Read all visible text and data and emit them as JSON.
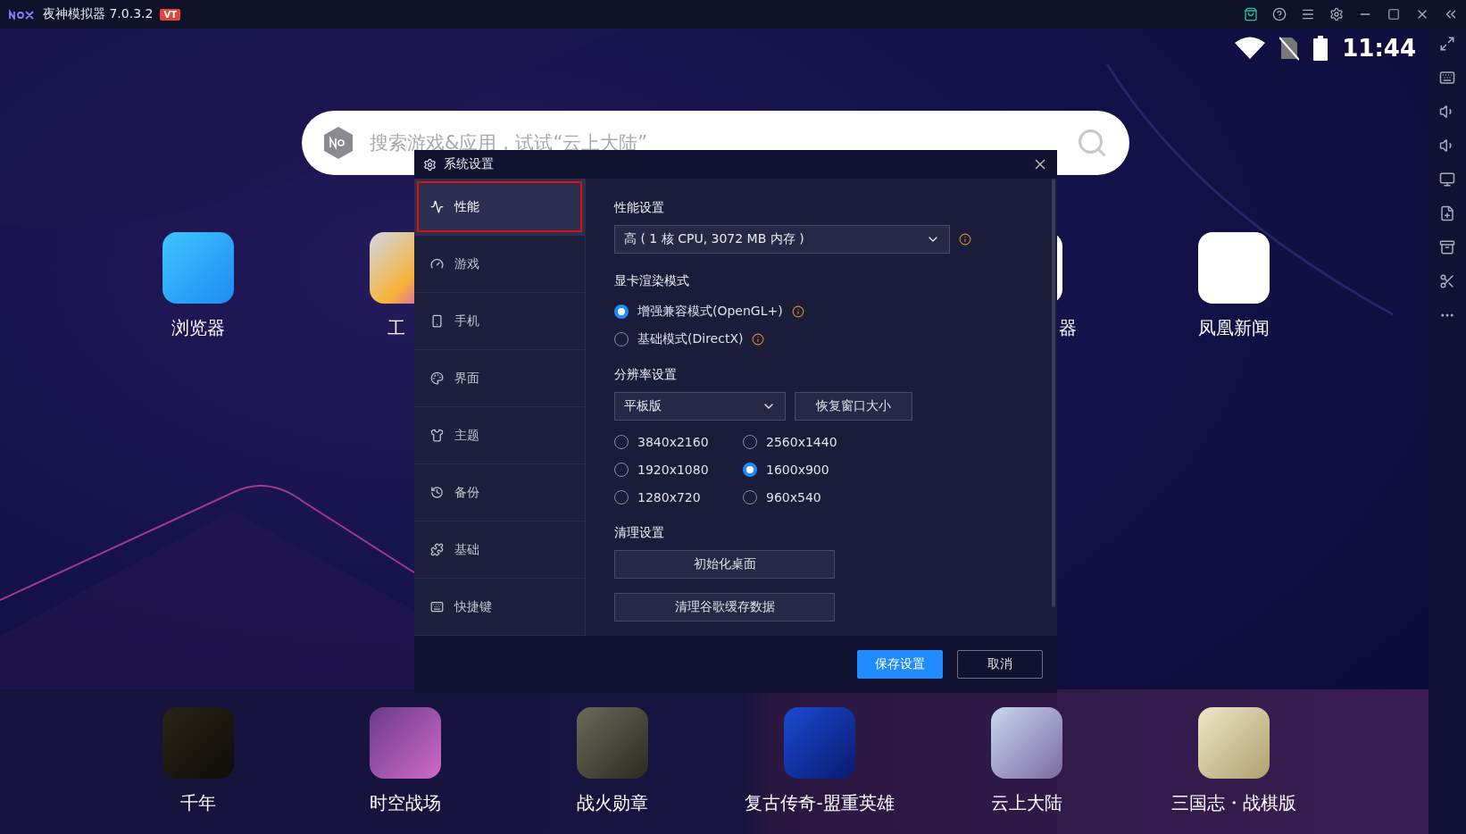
{
  "title_bar": {
    "app_name": "夜神模拟器 7.0.3.2",
    "badge": "VT"
  },
  "status_bar": {
    "time": "11:44"
  },
  "search": {
    "placeholder": "搜索游戏&应用，试试“云上大陆”"
  },
  "home_apps": [
    {
      "name": "浏览器",
      "kind": "full"
    },
    {
      "name": "工",
      "kind": "cut_right"
    },
    {
      "kind": "hidden"
    },
    {
      "kind": "hidden"
    },
    {
      "name": "器",
      "kind": "cut_left"
    },
    {
      "name": "凤凰新闻",
      "kind": "full"
    }
  ],
  "dock_apps": [
    {
      "name": "千年"
    },
    {
      "name": "时空战场"
    },
    {
      "name": "战火勋章"
    },
    {
      "name": "复古传奇-盟重英雄"
    },
    {
      "name": "云上大陆"
    },
    {
      "name": "三国志・战棋版"
    }
  ],
  "dialog": {
    "title": "系统设置",
    "sidebar": [
      {
        "label": "性能",
        "selected": true,
        "outlined": true
      },
      {
        "label": "游戏",
        "selected": false,
        "outlined": false
      },
      {
        "label": "手机",
        "selected": false,
        "outlined": false
      },
      {
        "label": "界面",
        "selected": false,
        "outlined": false
      },
      {
        "label": "主题",
        "selected": false,
        "outlined": false
      },
      {
        "label": "备份",
        "selected": false,
        "outlined": false
      },
      {
        "label": "基础",
        "selected": false,
        "outlined": false
      },
      {
        "label": "快捷键",
        "selected": false,
        "outlined": false
      }
    ],
    "performance": {
      "heading": "性能设置",
      "value": "高 ( 1 核 CPU, 3072 MB 内存 )"
    },
    "render": {
      "heading": "显卡渲染模式",
      "options": [
        {
          "label": "增强兼容模式(OpenGL+)",
          "selected": true
        },
        {
          "label": "基础模式(DirectX)",
          "selected": false
        }
      ]
    },
    "resolution": {
      "heading": "分辨率设置",
      "value": "平板版",
      "button": "恢复窗口大小",
      "options": [
        {
          "label": "3840x2160",
          "selected": false
        },
        {
          "label": "2560x1440",
          "selected": false
        },
        {
          "label": "1920x1080",
          "selected": false
        },
        {
          "label": "1600x900",
          "selected": true
        },
        {
          "label": "1280x720",
          "selected": false
        },
        {
          "label": "960x540",
          "selected": false
        }
      ]
    },
    "cleanup": {
      "heading": "清理设置",
      "buttons": [
        "初始化桌面",
        "清理谷歌缓存数据"
      ]
    },
    "footer": [
      {
        "label": "保存设置",
        "kind": "primary"
      },
      {
        "label": "取消",
        "kind": "secondary"
      }
    ]
  }
}
